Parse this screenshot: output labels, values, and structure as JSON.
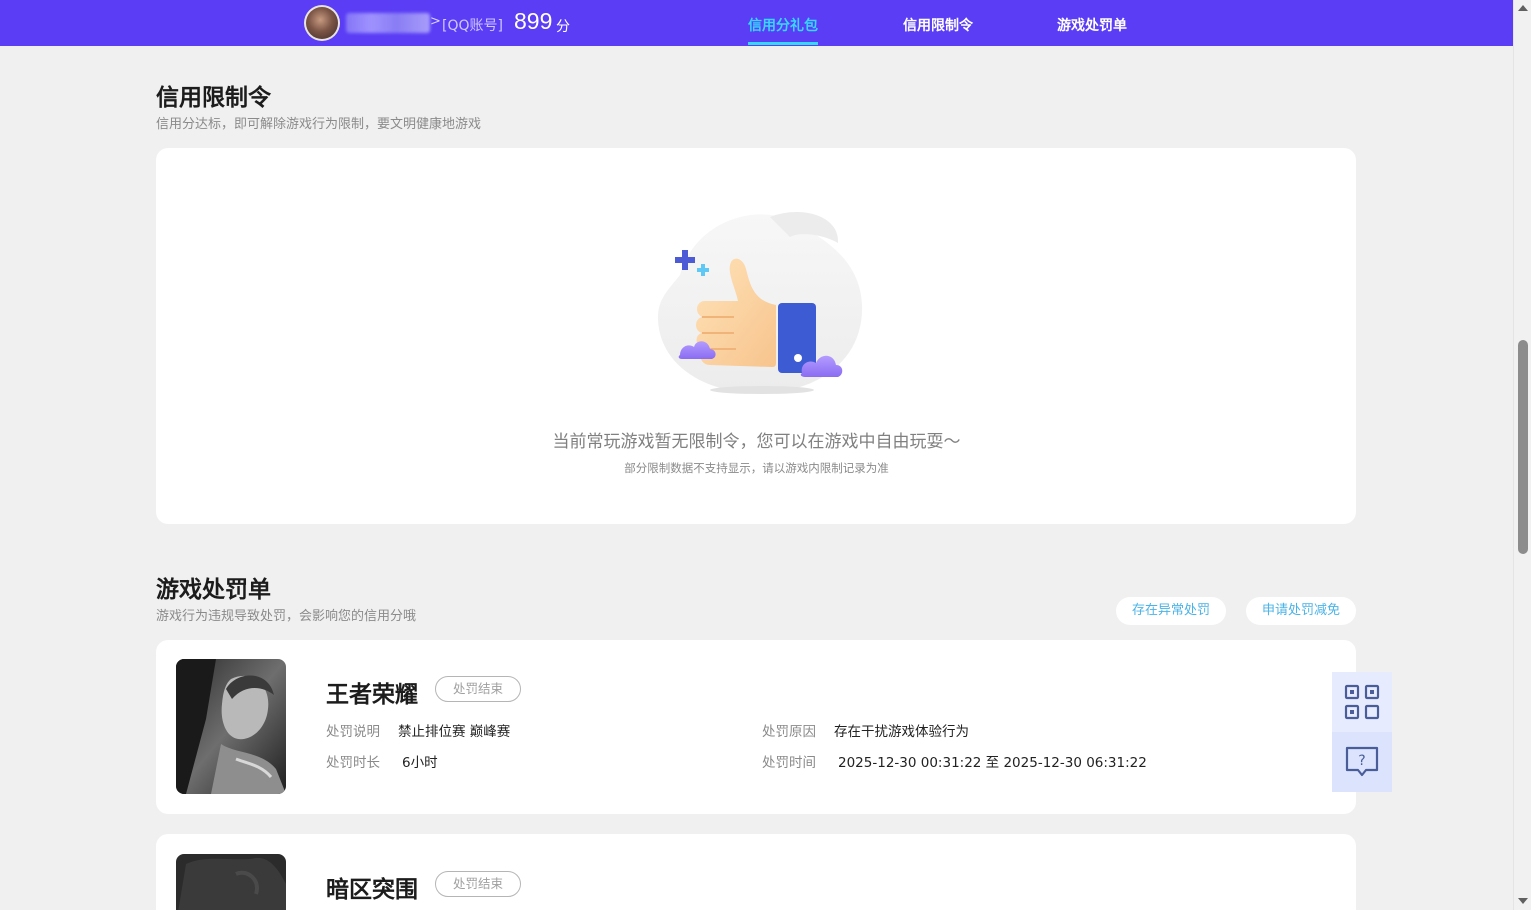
{
  "header": {
    "qq_label": "[QQ账号]",
    "score": "899",
    "score_unit": "分",
    "tabs": [
      {
        "label": "信用分礼包",
        "active": true
      },
      {
        "label": "信用限制令",
        "active": false
      },
      {
        "label": "游戏处罚单",
        "active": false
      }
    ],
    "accent_color": "#5a3df5",
    "active_tab_color": "#35d8ff"
  },
  "restriction": {
    "title": "信用限制令",
    "subtitle": "信用分达标，即可解除游戏行为限制，要文明健康地游戏",
    "empty_message": "当前常玩游戏暂无限制令，您可以在游戏中自由玩耍～",
    "empty_note": "部分限制数据不支持显示，请以游戏内限制记录为准"
  },
  "penalty": {
    "title": "游戏处罚单",
    "subtitle": "游戏行为违规导致处罚，会影响您的信用分哦",
    "actions": {
      "abnormal": "存在异常处罚",
      "appeal": "申请处罚减免"
    },
    "items": [
      {
        "game": "王者荣耀",
        "status": "处罚结束",
        "desc_label": "处罚说明",
        "desc": "禁止排位赛 巅峰赛",
        "reason_label": "处罚原因",
        "reason": "存在干扰游戏体验行为",
        "duration_label": "处罚时长",
        "duration": "6小时",
        "time_label": "处罚时间",
        "time": "2025-12-30 00:31:22 至 2025-12-30 06:31:22"
      },
      {
        "game": "暗区突围",
        "status": "处罚结束"
      }
    ]
  },
  "floating": {
    "qr_icon": "qr-code-icon",
    "help_icon": "help-chat-icon"
  }
}
